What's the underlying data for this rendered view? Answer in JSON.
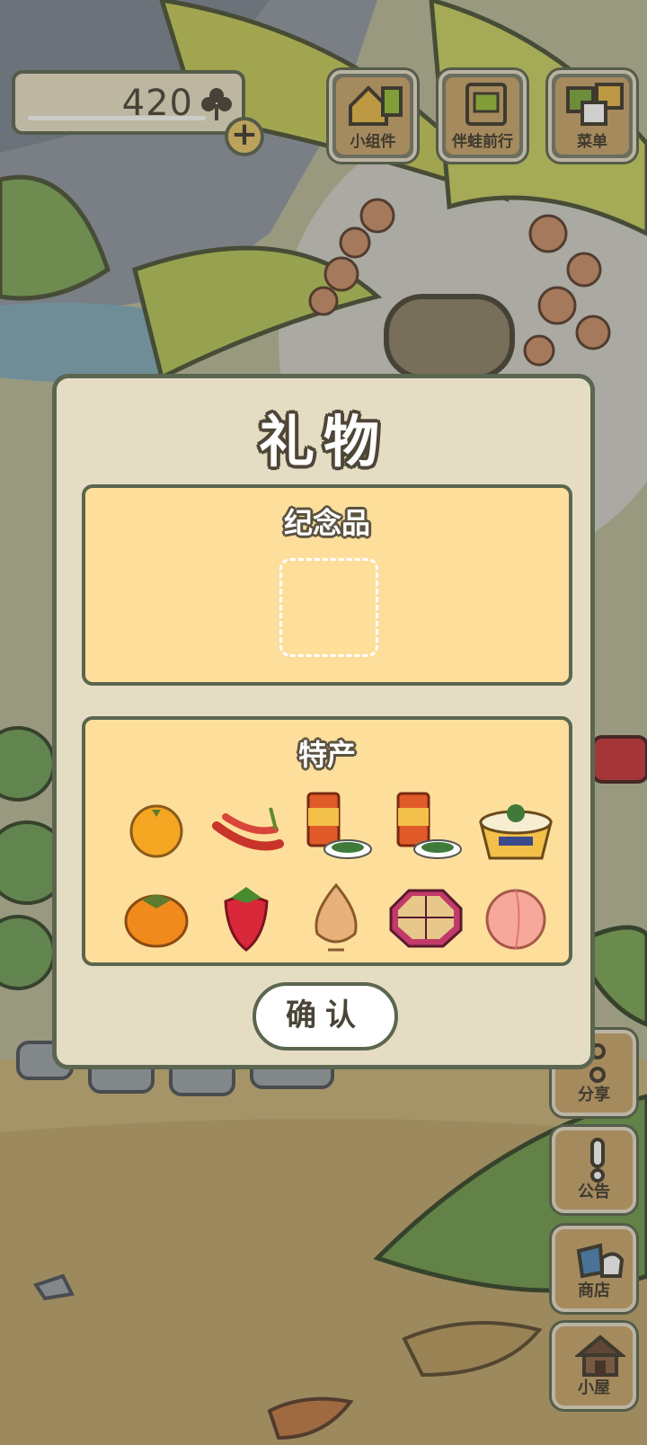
{
  "hud": {
    "clover_count": "420",
    "plus_label": "+"
  },
  "top_buttons": [
    {
      "label": "小组件"
    },
    {
      "label": "伴蛙前行"
    },
    {
      "label": "菜单"
    }
  ],
  "side_buttons": [
    {
      "label": "分享"
    },
    {
      "label": "公告"
    },
    {
      "label": "商店"
    },
    {
      "label": "小屋"
    }
  ],
  "dialog": {
    "title": "礼物",
    "souvenir_label": "纪念品",
    "specialty_label": "特产",
    "specialty_items": [
      {
        "name": "orange-icon"
      },
      {
        "name": "chili-pepper-icon"
      },
      {
        "name": "canned-drink-snack-icon"
      },
      {
        "name": "canned-drink-snack-icon"
      },
      {
        "name": "noodle-bowl-icon"
      },
      {
        "name": "persimmon-icon"
      },
      {
        "name": "strawberry-icon"
      },
      {
        "name": "onion-icon"
      },
      {
        "name": "bento-box-icon"
      },
      {
        "name": "peach-icon"
      }
    ],
    "confirm_label": "确认"
  },
  "colors": {
    "dialog_bg": "#e5ddc3",
    "panel_bg": "#fddf9b",
    "border": "#5b6650",
    "button_wood": "#c9a56d"
  }
}
